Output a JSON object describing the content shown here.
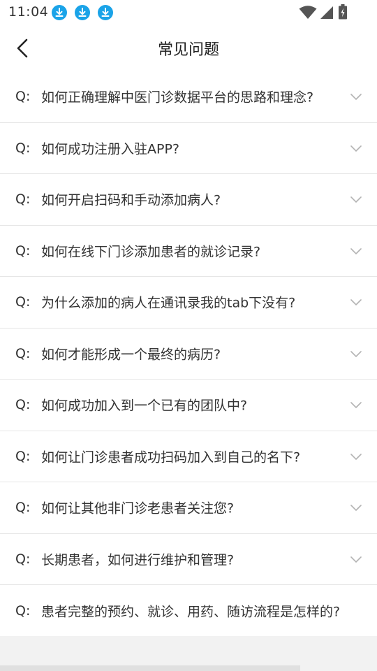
{
  "status_bar": {
    "time": "11:04",
    "notifications": [
      "download-icon",
      "download-icon",
      "download-icon"
    ],
    "indicators": [
      "wifi-icon",
      "signal-icon",
      "battery-icon"
    ],
    "accent_color": "#1aa3e8"
  },
  "header": {
    "back_icon": "chevron-left-icon",
    "title": "常见问题"
  },
  "faq": {
    "prefix": "Q:",
    "expand_icon": "chevron-down-icon",
    "items": [
      {
        "question": "如何正确理解中医门诊数据平台的思路和理念?"
      },
      {
        "question": "如何成功注册入驻APP?"
      },
      {
        "question": "如何开启扫码和手动添加病人?"
      },
      {
        "question": "如何在线下门诊添加患者的就诊记录?"
      },
      {
        "question": "为什么添加的病人在通讯录我的tab下没有?"
      },
      {
        "question": "如何才能形成一个最终的病历?"
      },
      {
        "question": "如何成功加入到一个已有的团队中?"
      },
      {
        "question": "如何让门诊患者成功扫码加入到自己的名下?"
      },
      {
        "question": "如何让其他非门诊老患者关注您?"
      },
      {
        "question": "长期患者，如何进行维护和管理?"
      },
      {
        "question": "患者完整的预约、就诊、用药、随访流程是怎样的?"
      }
    ]
  }
}
